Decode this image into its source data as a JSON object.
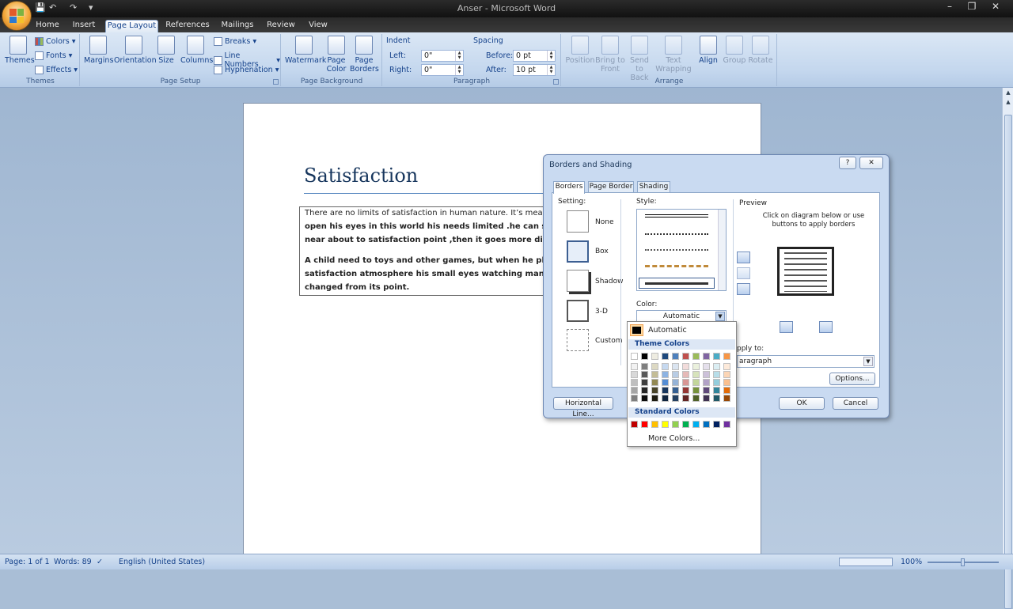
{
  "window": {
    "title": "Anser - Microsoft Word"
  },
  "tabs": [
    "Home",
    "Insert",
    "Page Layout",
    "References",
    "Mailings",
    "Review",
    "View"
  ],
  "active_tab": "Page Layout",
  "ribbon": {
    "themes_group": {
      "label": "Themes",
      "themes": "Themes",
      "colors": "Colors",
      "fonts": "Fonts",
      "effects": "Effects"
    },
    "page_setup_group": {
      "label": "Page Setup",
      "margins": "Margins",
      "orientation": "Orientation",
      "size": "Size",
      "columns": "Columns",
      "breaks": "Breaks",
      "line_numbers": "Line Numbers",
      "hyphenation": "Hyphenation"
    },
    "page_background_group": {
      "label": "Page Background",
      "watermark": "Watermark",
      "page_color_1": "Page",
      "page_color_2": "Color",
      "page_borders_1": "Page",
      "page_borders_2": "Borders"
    },
    "paragraph_group": {
      "label": "Paragraph",
      "indent": "Indent",
      "left": "Left:",
      "left_value": "0\"",
      "right": "Right:",
      "right_value": "0\"",
      "spacing": "Spacing",
      "before": "Before:",
      "before_value": "0 pt",
      "after": "After:",
      "after_value": "10 pt"
    },
    "arrange_group": {
      "label": "Arrange",
      "position": "Position",
      "bring_front_1": "Bring to",
      "bring_front_2": "Front",
      "send_back_1": "Send to",
      "send_back_2": "Back",
      "text_wrapping_1": "Text",
      "text_wrapping_2": "Wrapping",
      "align": "Align",
      "group": "Group",
      "rotate": "Rotate"
    }
  },
  "document": {
    "title": "Satisfaction",
    "lines": [
      "There are no limits of satisfaction in  human nature. It’s meaning",
      "open his eyes in this world his needs limited .he can see his sati",
      "near about to satisfaction point ,then it goes more distance fro",
      "A child need to toys and other games, but  when he playing gam",
      "satisfaction atmosphere his small eyes watching many dreams.",
      "changed from its point."
    ]
  },
  "dialog": {
    "title": "Borders and Shading",
    "help": "?",
    "close": "✕",
    "tabs": [
      "Borders",
      "Page Border",
      "Shading"
    ],
    "setting_label": "Setting:",
    "settings": [
      "None",
      "Box",
      "Shadow",
      "3-D",
      "Custom"
    ],
    "selected_setting": "Box",
    "style_label": "Style:",
    "color_label": "Color:",
    "color_value": "Automatic",
    "preview_label": "Preview",
    "preview_hint_1": "Click on diagram below or use",
    "preview_hint_2": "buttons to apply borders",
    "apply_to_label": "pply to:",
    "apply_to_value": "aragraph",
    "options_button": "Options...",
    "horizontal_line_button": "Horizontal Line...",
    "ok_button": "OK",
    "cancel_button": "Cancel"
  },
  "color_popup": {
    "automatic": "Automatic",
    "theme_colors_label": "Theme Colors",
    "standard_colors_label": "Standard Colors",
    "more_colors": "More Colors...",
    "theme_top": [
      "#ffffff",
      "#000000",
      "#eeece1",
      "#1f497d",
      "#4f81bd",
      "#c0504d",
      "#9bbb59",
      "#8064a2",
      "#4bacc6",
      "#f79646"
    ],
    "theme_shades": [
      [
        "#f2f2f2",
        "#d8d8d8",
        "#bfbfbf",
        "#a5a5a5",
        "#7f7f7f"
      ],
      [
        "#7f7f7f",
        "#595959",
        "#3f3f3f",
        "#262626",
        "#0c0c0c"
      ],
      [
        "#ddd9c3",
        "#c4bd97",
        "#938953",
        "#494429",
        "#1d1b10"
      ],
      [
        "#c6d9f0",
        "#8db3e2",
        "#548dd4",
        "#17365d",
        "#0f243e"
      ],
      [
        "#dbe5f1",
        "#b8cce4",
        "#95b3d7",
        "#366092",
        "#244061"
      ],
      [
        "#f2dcdb",
        "#e5b9b7",
        "#d99694",
        "#953734",
        "#632423"
      ],
      [
        "#ebf1dd",
        "#d7e3bc",
        "#c3d69b",
        "#76923c",
        "#4f6128"
      ],
      [
        "#e5e0ec",
        "#ccc1d9",
        "#b2a2c7",
        "#5f497a",
        "#3f3151"
      ],
      [
        "#dbeef3",
        "#b7dde8",
        "#92cddc",
        "#31859b",
        "#205867"
      ],
      [
        "#fdeada",
        "#fbd5b5",
        "#fac08f",
        "#e36c09",
        "#974806"
      ]
    ],
    "standard": [
      "#c00000",
      "#ff0000",
      "#ffc000",
      "#ffff00",
      "#92d050",
      "#00b050",
      "#00b0f0",
      "#0070c0",
      "#002060",
      "#7030a0"
    ]
  },
  "status": {
    "page": "Page: 1 of 1",
    "words": "Words: 89",
    "language": "English (United States)",
    "zoom": "100%"
  }
}
